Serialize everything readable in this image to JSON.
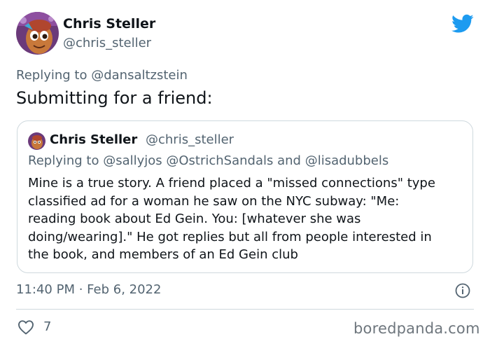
{
  "author": {
    "display_name": "Chris Steller",
    "handle": "@chris_steller"
  },
  "tweet": {
    "replying_to": "Replying to @dansaltzstein",
    "text": "Submitting for a friend:",
    "timestamp": "11:40 PM · Feb 6, 2022",
    "likes": "7"
  },
  "quoted_tweet": {
    "display_name": "Chris Steller",
    "handle": "@chris_steller",
    "replying_to": "Replying to @sallyjos @OstrichSandals and @lisadubbels",
    "text_lines": [
      "Mine is a true story. A friend placed a \"missed connections\" type",
      "classified ad for a woman he saw on the NYC subway: \"Me:",
      "reading book about Ed Gein. You: [whatever she was",
      "doing/wearing].\" He got replies but all from people interested in",
      "the book, and members of an Ed Gein club"
    ]
  },
  "watermark": "boredpanda.com",
  "colors": {
    "twitter_blue": "#1d9bf0",
    "secondary_text": "#536471",
    "border": "#cfd9de"
  },
  "icons": {
    "logo": "twitter-bird-icon",
    "info": "info-icon",
    "like": "heart-icon"
  }
}
